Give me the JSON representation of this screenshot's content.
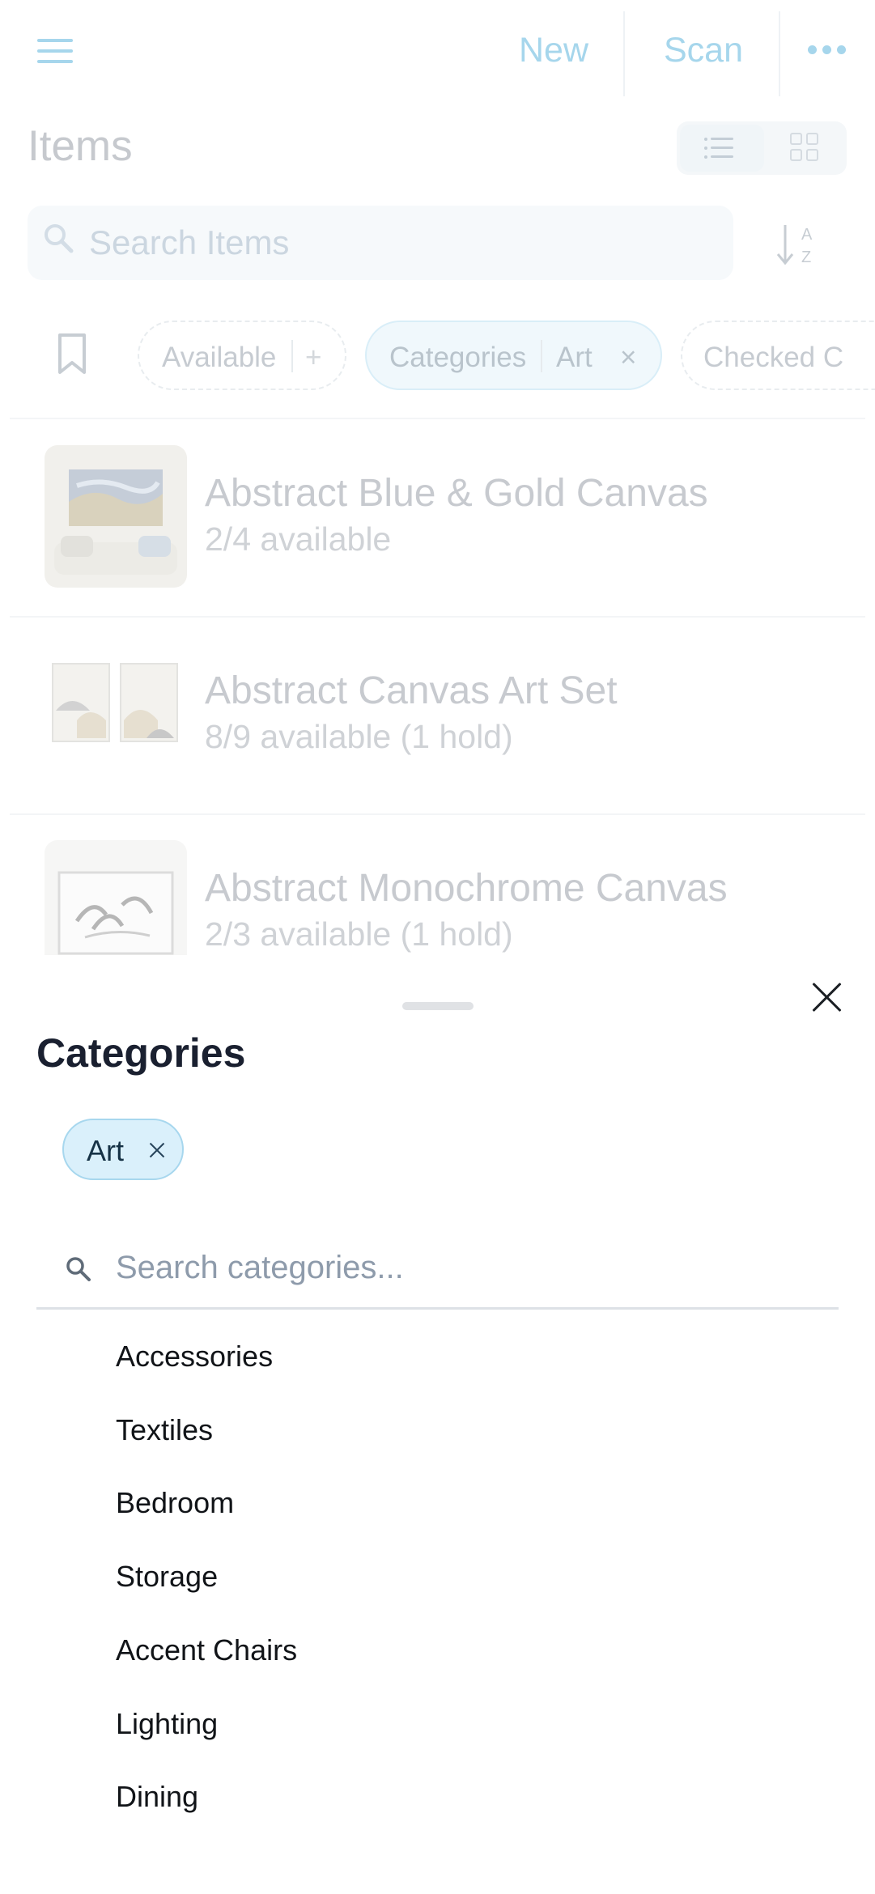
{
  "topbar": {
    "new_label": "New",
    "scan_label": "Scan"
  },
  "page": {
    "title": "Items"
  },
  "search": {
    "placeholder": "Search Items"
  },
  "filters": {
    "available": {
      "label": "Available",
      "action": "+"
    },
    "categories": {
      "label": "Categories",
      "value": "Art",
      "remove": "×"
    },
    "checked": {
      "label": "Checked C"
    }
  },
  "items": [
    {
      "name": "Abstract Blue & Gold Canvas",
      "availability": "2/4 available"
    },
    {
      "name": "Abstract Canvas Art Set",
      "availability": "8/9 available (1 hold)"
    },
    {
      "name": "Abstract Monochrome Canvas",
      "availability": "2/3 available (1 hold)"
    }
  ],
  "sheet": {
    "title": "Categories",
    "selected_chip": "Art",
    "search_placeholder": "Search categories...",
    "options": [
      "Accessories",
      "Textiles",
      "Bedroom",
      "Storage",
      "Accent Chairs",
      "Lighting",
      "Dining"
    ]
  },
  "colors": {
    "accent": "#a6d6ec",
    "chip_selected_bg": "#daf0fb",
    "chip_selected_border": "#a7d7ee",
    "sheet_title": "#1a2030"
  },
  "icons": [
    "menu-icon",
    "more-icon",
    "list-view-icon",
    "grid-view-icon",
    "search-icon",
    "sort-az-icon",
    "bookmark-icon",
    "close-icon"
  ]
}
